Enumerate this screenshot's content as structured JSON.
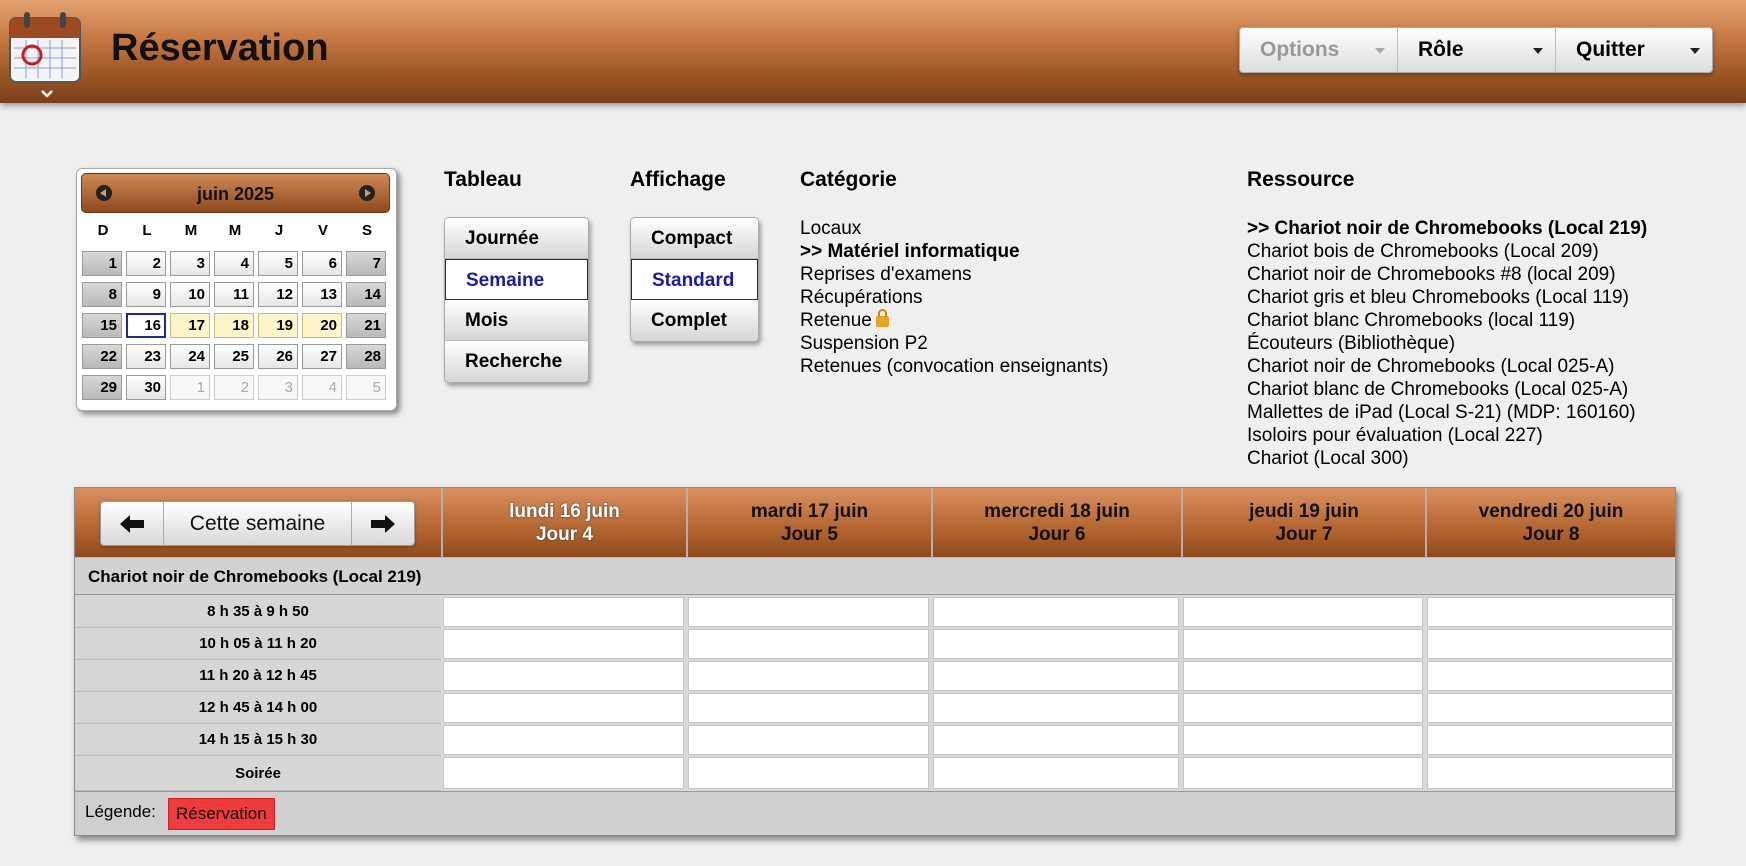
{
  "header": {
    "title": "Réservation",
    "menus": [
      {
        "label": "Options",
        "disabled": true
      },
      {
        "label": "Rôle",
        "disabled": false
      },
      {
        "label": "Quitter",
        "disabled": false
      }
    ]
  },
  "minical": {
    "title": "juin 2025",
    "dow": [
      "D",
      "L",
      "M",
      "M",
      "J",
      "V",
      "S"
    ],
    "weeks": [
      [
        "1",
        "2",
        "3",
        "4",
        "5",
        "6",
        "7"
      ],
      [
        "8",
        "9",
        "10",
        "11",
        "12",
        "13",
        "14"
      ],
      [
        "15",
        "16",
        "17",
        "18",
        "19",
        "20",
        "21"
      ],
      [
        "22",
        "23",
        "24",
        "25",
        "26",
        "27",
        "28"
      ],
      [
        "29",
        "30",
        "1",
        "2",
        "3",
        "4",
        "5"
      ]
    ]
  },
  "tableau": {
    "title": "Tableau",
    "options": [
      "Journée",
      "Semaine",
      "Mois",
      "Recherche"
    ]
  },
  "affichage": {
    "title": "Affichage",
    "options": [
      "Compact",
      "Standard",
      "Complet"
    ]
  },
  "categorie": {
    "title": "Catégorie",
    "items": [
      "Locaux",
      ">> Matériel informatique",
      "Reprises d'examens",
      "Récupérations",
      "Retenue",
      "Suspension P2",
      "Retenues (convocation enseignants)"
    ]
  },
  "ressource": {
    "title": "Ressource",
    "items": [
      ">> Chariot noir de Chromebooks (Local 219)",
      "Chariot bois de Chromebooks (Local 209)",
      "Chariot noir de Chromebooks #8 (local 209)",
      "Chariot gris et bleu Chromebooks (Local 119)",
      "Chariot blanc Chromebooks (local 119)",
      "Écouteurs (Bibliothèque)",
      "Chariot noir de Chromebooks (Local 025-A)",
      "Chariot blanc de Chromebooks (Local 025-A)",
      "Mallettes de iPad (Local S-21) (MDP: 160160)",
      "Isoloirs pour évaluation (Local 227)",
      "Chariot (Local 300)"
    ]
  },
  "schedule": {
    "nav_label": "Cette semaine",
    "days": [
      {
        "date": "lundi 16 juin",
        "jour": "Jour 4"
      },
      {
        "date": "mardi 17 juin",
        "jour": "Jour 5"
      },
      {
        "date": "mercredi 18 juin",
        "jour": "Jour 6"
      },
      {
        "date": "jeudi 19 juin",
        "jour": "Jour 7"
      },
      {
        "date": "vendredi 20 juin",
        "jour": "Jour 8"
      }
    ],
    "resource_name": "Chariot noir de Chromebooks (Local 219)",
    "periods": [
      "8 h 35 à 9 h 50",
      "10 h 05 à 11 h 20",
      "11 h 20 à 12 h 45",
      "12 h 45 à 14 h 00",
      "14 h 15 à 15 h 30",
      "Soirée"
    ],
    "legend_label": "Légende:",
    "legend_item": "Réservation"
  }
}
